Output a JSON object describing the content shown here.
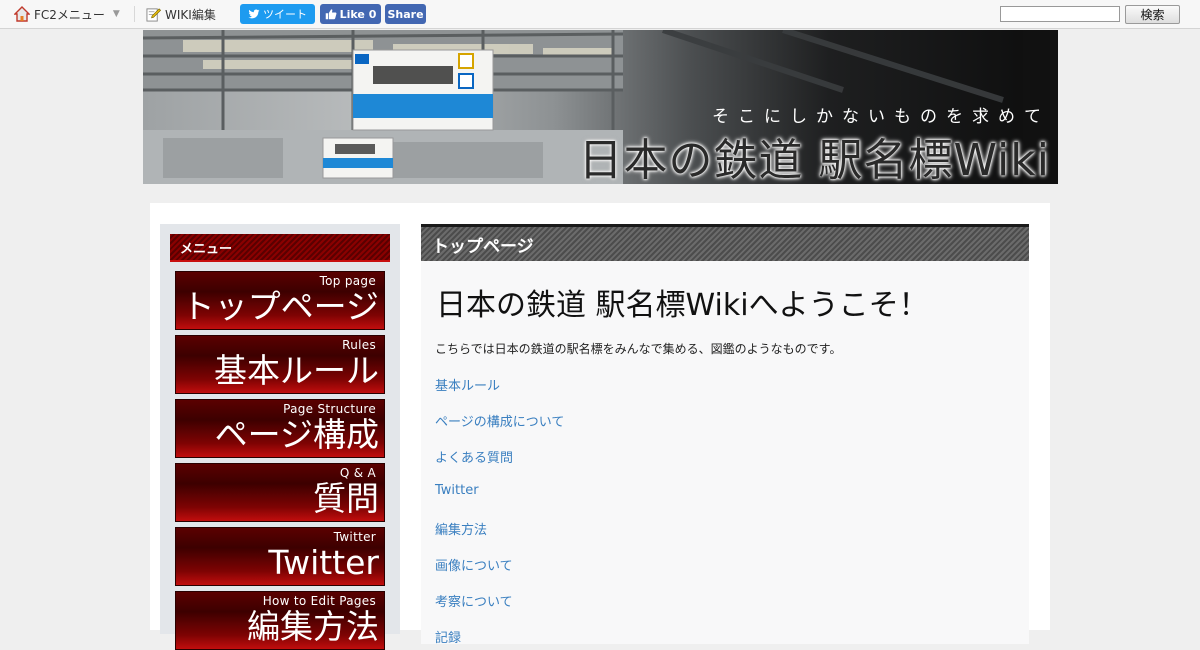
{
  "topbar": {
    "fc2_menu_label": "FC2メニュー",
    "wiki_edit_label": "WIKI編集",
    "tweet_label": "ツイート",
    "like_label": "Like 0",
    "share_label": "Share",
    "search_value": "",
    "search_button_label": "検索"
  },
  "banner": {
    "subtitle": "そこにしかないものを求めて",
    "title": "日本の鉄道 駅名標Wiki"
  },
  "sidebar": {
    "heading": "メニュー",
    "items": [
      {
        "en": "Top page",
        "jp": "トップページ"
      },
      {
        "en": "Rules",
        "jp": "基本ルール"
      },
      {
        "en": "Page Structure",
        "jp": "ページ構成"
      },
      {
        "en": "Q & A",
        "jp": "質問"
      },
      {
        "en": "Twitter",
        "jp": "Twitter"
      },
      {
        "en": "How to Edit Pages",
        "jp": "編集方法"
      }
    ]
  },
  "content": {
    "heading": "トップページ",
    "title": "日本の鉄道 駅名標Wikiへようこそ！",
    "intro": "こちらでは日本の鉄道の駅名標をみんなで集める、図鑑のようなものです。",
    "links": [
      "基本ルール",
      "ページの構成について",
      "よくある質問",
      "Twitter",
      "編集方法",
      "画像について",
      "考察について",
      "記録"
    ]
  },
  "colors": {
    "menu_red": "#7e0303",
    "link_blue": "#3a7fc0",
    "tweet_blue": "#1d9bf0",
    "facebook_blue": "#4267b2"
  },
  "icons": [
    "house-icon",
    "pencil-icon",
    "twitter-bird-icon",
    "thumbs-up-icon"
  ]
}
